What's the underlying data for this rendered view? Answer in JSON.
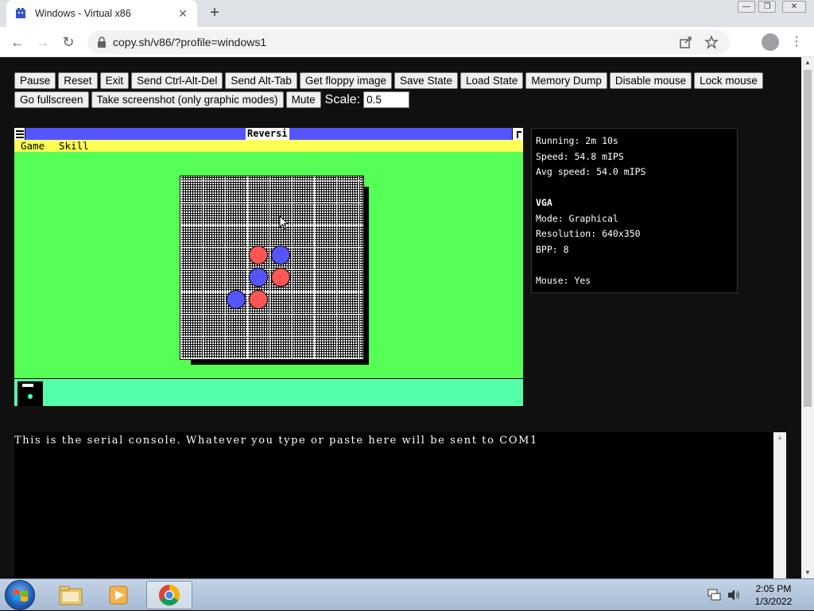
{
  "browser": {
    "tab_title": "Windows - Virtual x86",
    "tab_close": "✕",
    "new_tab": "+",
    "window_controls": {
      "minimize": "—",
      "restore": "❐",
      "close": "✕"
    },
    "nav": {
      "back": "←",
      "forward": "→",
      "reload": "↻"
    },
    "url": "copy.sh/v86/?profile=windows1",
    "omnibox_icons": [
      "share-icon",
      "star-icon"
    ],
    "menu": "⋮"
  },
  "controls": {
    "buttons": [
      "Pause",
      "Reset",
      "Exit",
      "Send Ctrl-Alt-Del",
      "Send Alt-Tab",
      "Get floppy image",
      "Save State",
      "Load State",
      "Memory Dump",
      "Disable mouse",
      "Lock mouse",
      "Go fullscreen",
      "Take screenshot (only graphic modes)",
      "Mute"
    ],
    "scale_label": "Scale:",
    "scale_value": "0.5"
  },
  "emulator": {
    "window_title": "Reversi",
    "menu": {
      "game": "Game",
      "skill": "Skill"
    },
    "board": {
      "size": 8,
      "pieces": [
        {
          "row": 3,
          "col": 3,
          "color": "red"
        },
        {
          "row": 3,
          "col": 4,
          "color": "blue"
        },
        {
          "row": 4,
          "col": 3,
          "color": "blue"
        },
        {
          "row": 4,
          "col": 4,
          "color": "red"
        },
        {
          "row": 5,
          "col": 2,
          "color": "blue"
        },
        {
          "row": 5,
          "col": 3,
          "color": "red"
        }
      ]
    },
    "colors": {
      "desktop": "#55ff55",
      "titlebar": "#5555ff",
      "menubar": "#ffff55",
      "iconbar": "#55ffaa",
      "red_piece": "#ff5555",
      "blue_piece": "#5555ff"
    }
  },
  "stats": {
    "running": "Running: 2m 10s",
    "speed": "Speed: 54.8 mIPS",
    "avg_speed": "Avg speed: 54.0 mIPS",
    "vga_heading": "VGA",
    "mode": "Mode: Graphical",
    "resolution": "Resolution: 640x350",
    "bpp": "BPP: 8",
    "mouse": "Mouse: Yes"
  },
  "serial": {
    "text": "This is the serial console. Whatever you type or paste here will be sent to COM1"
  },
  "taskbar": {
    "items": [
      "explorer-icon",
      "media-player-icon",
      "chrome-icon"
    ],
    "time": "2:05 PM",
    "date": "1/3/2022"
  }
}
